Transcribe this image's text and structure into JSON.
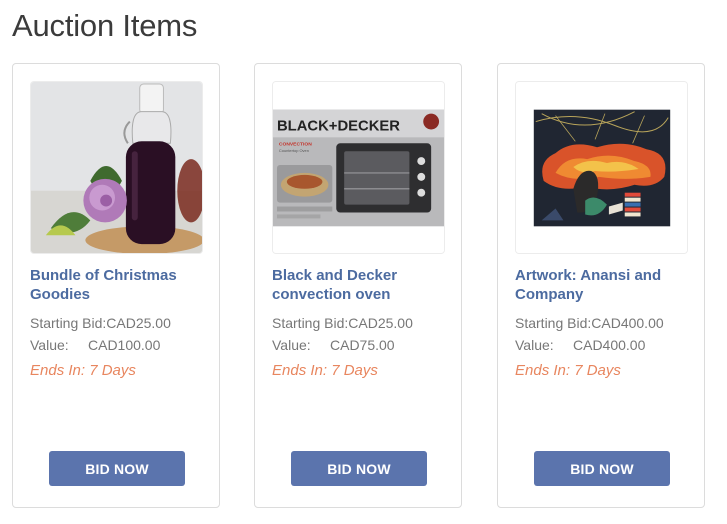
{
  "page": {
    "title": "Auction Items"
  },
  "items": [
    {
      "title": "Bundle of Christmas Goodies",
      "starting_bid_label": "Starting Bid:",
      "starting_bid": "CAD25.00",
      "value_label": "Value:",
      "value": "CAD100.00",
      "ends": "Ends In: 7 Days",
      "button": "BID NOW",
      "image": "bottle-and-flower-photo"
    },
    {
      "title": "Black and Decker convection oven",
      "starting_bid_label": "Starting Bid:",
      "starting_bid": "CAD25.00",
      "value_label": "Value:",
      "value": "CAD75.00",
      "ends": "Ends In: 7 Days",
      "button": "BID NOW",
      "image": "toaster-oven-box-photo",
      "image_text": {
        "brand": "BLACK+DECKER",
        "subtitle": "CONVECTION",
        "caption": "Countertop Oven"
      }
    },
    {
      "title": "Artwork: Anansi and Company",
      "starting_bid_label": "Starting Bid:",
      "starting_bid": "CAD400.00",
      "value_label": "Value:",
      "value": "CAD400.00",
      "ends": "Ends In: 7 Days",
      "button": "BID NOW",
      "image": "painting-photo"
    }
  ],
  "colors": {
    "title_link": "#4c6ba0",
    "ends": "#e8865f",
    "button": "#5b74ad",
    "border": "#dcdcdc"
  }
}
